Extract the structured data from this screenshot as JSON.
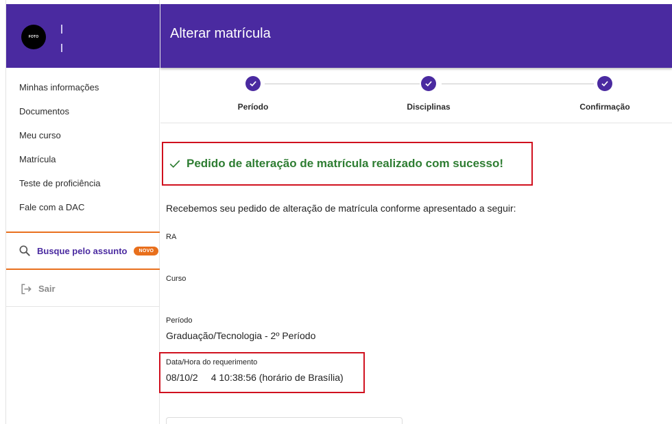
{
  "sidebar": {
    "avatar_text": "FOTO",
    "items": [
      {
        "label": "Minhas informações"
      },
      {
        "label": "Documentos"
      },
      {
        "label": "Meu curso"
      },
      {
        "label": "Matrícula"
      },
      {
        "label": "Teste de proficiência"
      },
      {
        "label": "Fale com a DAC"
      }
    ],
    "search": {
      "label": "Busque pelo assunto",
      "badge": "NOVO",
      "icon": "search-icon"
    },
    "logout": {
      "label": "Sair",
      "icon": "logout-icon"
    }
  },
  "header": {
    "title": "Alterar matrícula"
  },
  "stepper": {
    "steps": [
      {
        "label": "Período",
        "state": "done"
      },
      {
        "label": "Disciplinas",
        "state": "done"
      },
      {
        "label": "Confirmação",
        "state": "done"
      }
    ]
  },
  "success": {
    "message": "Pedido de alteração de matrícula realizado com sucesso!"
  },
  "intro": "Recebemos seu pedido de alteração de matrícula conforme apresentado a seguir:",
  "fields": {
    "ra": {
      "label": "RA",
      "value": ""
    },
    "curso": {
      "label": "Curso",
      "value": ""
    },
    "periodo": {
      "label": "Período",
      "value": "Graduação/Tecnologia - 2º Período"
    },
    "data_hora": {
      "label": "Data/Hora do requerimento",
      "value": "08/10/2",
      "value_suffix": "4 10:38:56 (horário de Brasília)"
    }
  },
  "colors": {
    "brand_purple": "#4a2aa0",
    "accent_orange": "#e86f1c",
    "success_green": "#2e7d32",
    "highlight_red": "#d0101e"
  }
}
